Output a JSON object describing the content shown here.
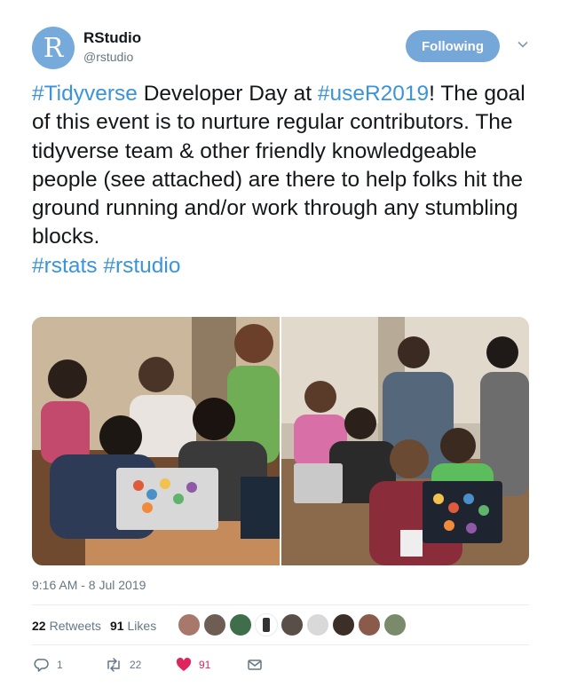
{
  "account": {
    "avatar_letter": "R",
    "name": "RStudio",
    "handle": "@rstudio",
    "follow_label": "Following"
  },
  "tweet": {
    "hashtag_tidyverse": "#Tidyverse",
    "text_part1": " Developer Day at ",
    "hashtag_user2019": "#useR2019",
    "text_part2": "! The goal of this event is to nurture regular contributors. The tidyverse team & other friendly knowledgeable people (see attached) are there to help folks hit the ground running and/or work through any stumbling blocks.",
    "hashtag_rstats": "#rstats",
    "hashtag_rstudio": "#rstudio"
  },
  "timestamp": "9:16 AM - 8 Jul 2019",
  "stats": {
    "retweets_count": "22",
    "retweets_label": "Retweets",
    "likes_count": "91",
    "likes_label": "Likes"
  },
  "actions": {
    "reply_count": "1",
    "retweet_count": "22",
    "like_count": "91"
  },
  "colors": {
    "accent": "#3b94d9",
    "follow_button": "#76a7d9",
    "like": "#e0245e",
    "muted": "#657786"
  },
  "icons": [
    "chevron-down-icon",
    "reply-icon",
    "retweet-icon",
    "heart-icon",
    "mail-icon"
  ]
}
